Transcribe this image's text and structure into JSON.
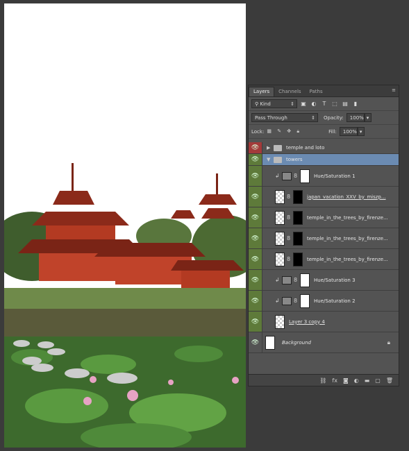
{
  "panel": {
    "tabs": [
      "Layers",
      "Channels",
      "Paths"
    ],
    "kind_label": "Kind",
    "blend_mode": "Pass Through",
    "opacity_label": "Opacity:",
    "opacity_value": "100%",
    "lock_label": "Lock:",
    "fill_label": "Fill:",
    "fill_value": "100%"
  },
  "layers": [
    {
      "name": "temple and loto",
      "type": "group-collapsed",
      "eye_color": "red"
    },
    {
      "name": "towers",
      "type": "group-expanded",
      "eye_color": "green",
      "selected": true
    },
    {
      "name": "Hue/Saturation 1",
      "type": "adjustment",
      "eye_color": "green"
    },
    {
      "name": "japan_vacation_XXV_by_miszp...",
      "type": "masked",
      "eye_color": "green"
    },
    {
      "name": "temple_in_the_trees_by_firenze...",
      "type": "masked",
      "eye_color": "green"
    },
    {
      "name": "temple_in_the_trees_by_firenze...",
      "type": "masked",
      "eye_color": "green"
    },
    {
      "name": "temple_in_the_trees_by_firenze...",
      "type": "masked",
      "eye_color": "green"
    },
    {
      "name": "Hue/Saturation 3",
      "type": "adjustment",
      "eye_color": "green"
    },
    {
      "name": "Hue/Saturation 2",
      "type": "adjustment",
      "eye_color": "green"
    },
    {
      "name": "Layer 3 copy 4",
      "type": "pixel",
      "eye_color": "green"
    },
    {
      "name": "Background",
      "type": "background",
      "eye_color": "none"
    }
  ],
  "colors": {
    "accent_selected": "#6b8bb2",
    "eye_green": "#5e7a3a",
    "eye_red": "#a33a3a"
  }
}
